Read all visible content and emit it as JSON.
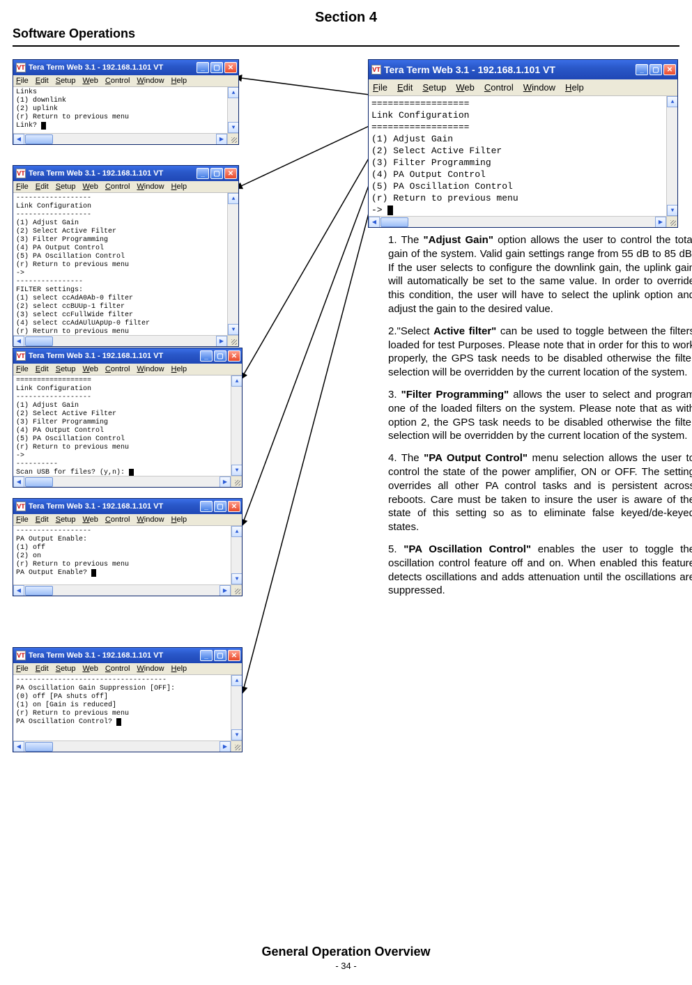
{
  "header": {
    "section": "Section 4",
    "title": "Software Operations"
  },
  "menus": {
    "file": "File",
    "edit": "Edit",
    "setup": "Setup",
    "web": "Web",
    "control": "Control",
    "window": "Window",
    "help": "Help"
  },
  "windows": {
    "common_title": "Tera Term Web 3.1 - 192.168.1.101 VT",
    "w1": {
      "body": "Links\n(1) downlink\n(2) uplink\n(r) Return to previous menu\nLink? "
    },
    "w2": {
      "body": "------------------\nLink Configuration\n------------------\n(1) Adjust Gain\n(2) Select Active Filter\n(3) Filter Programming\n(4) PA Output Control\n(5) PA Oscillation Control\n(r) Return to previous menu\n->\n----------------\nFILTER settings:\n(1) select ccAdA0Ab-0 filter\n(2) select ccBUUp-1 filter\n(3) select ccFullWide filter\n(4) select ccAdAUlUApUp-0 filter\n(r) Return to previous menu\nFILTER settings? "
    },
    "w3": {
      "body": "==================\nLink Configuration\n------------------\n(1) Adjust Gain\n(2) Select Active Filter\n(3) Filter Programming\n(4) PA Output Control\n(5) PA Oscillation Control\n(r) Return to previous menu\n->\n----------\nScan USB for files? (y,n): "
    },
    "w4": {
      "body": "------------------\nPA Output Enable:\n(1) off\n(2) on\n(r) Return to previous menu\nPA Output Enable? "
    },
    "w5": {
      "body": "------------------------------------\nPA Oscillation Gain Suppression [OFF]:\n(0) off [PA shuts off]\n(1) on [Gain is reduced]\n(r) Return to previous menu\nPA Oscillation Control? "
    },
    "wbig": {
      "body": "==================\nLink Configuration\n==================\n(1) Adjust Gain\n(2) Select Active Filter\n(3) Filter Programming\n(4) PA Output Control\n(5) PA Oscillation Control\n(r) Return to previous menu\n-> "
    }
  },
  "notes": {
    "p1a": "1. The ",
    "p1kw": "\"Adjust Gain\"",
    "p1b": " option allows the user to control the total gain of the system. Valid gain settings range from 55 dB to 85 dB. If the user selects to configure the downlink gain, the uplink gain will automatically be set to the same value. In order to override this condition, the user will have to select the uplink option and adjust the gain to the desired value.",
    "p2a": "2.\"Select ",
    "p2kw": "Active filter\"",
    "p2b": " can be used to toggle between the filters loaded for test Purposes. Please note that in order for this to work properly, the GPS task needs to be disabled otherwise the filter selection will be overridden by the current location of the system.",
    "p3a": "3. ",
    "p3kw": "\"Filter Programming\"",
    "p3b": " allows the user to select and program one of the loaded filters on the system. Please note that as with option 2, the GPS task needs to be disabled otherwise the filter selection will be overridden by the current location of the system.",
    "p4a": "4. The ",
    "p4kw": "\"PA Output Control\"",
    "p4b": " menu selection allows the user to control the state of the power amplifier, ON or OFF. The setting overrides all other PA control tasks and is persistent across reboots. Care must be taken to insure the user is aware of the state of this setting so as to eliminate false keyed/de-keyed states.",
    "p5a": "5. ",
    "p5kw": "\"PA Oscillation Control\"",
    "p5b": " enables the user to toggle the oscillation control feature off and on. When enabled this feature detects oscillations and adds attenuation until the oscillations are suppressed."
  },
  "footer": {
    "title": "General Operation Overview",
    "page": "- 34 -"
  }
}
